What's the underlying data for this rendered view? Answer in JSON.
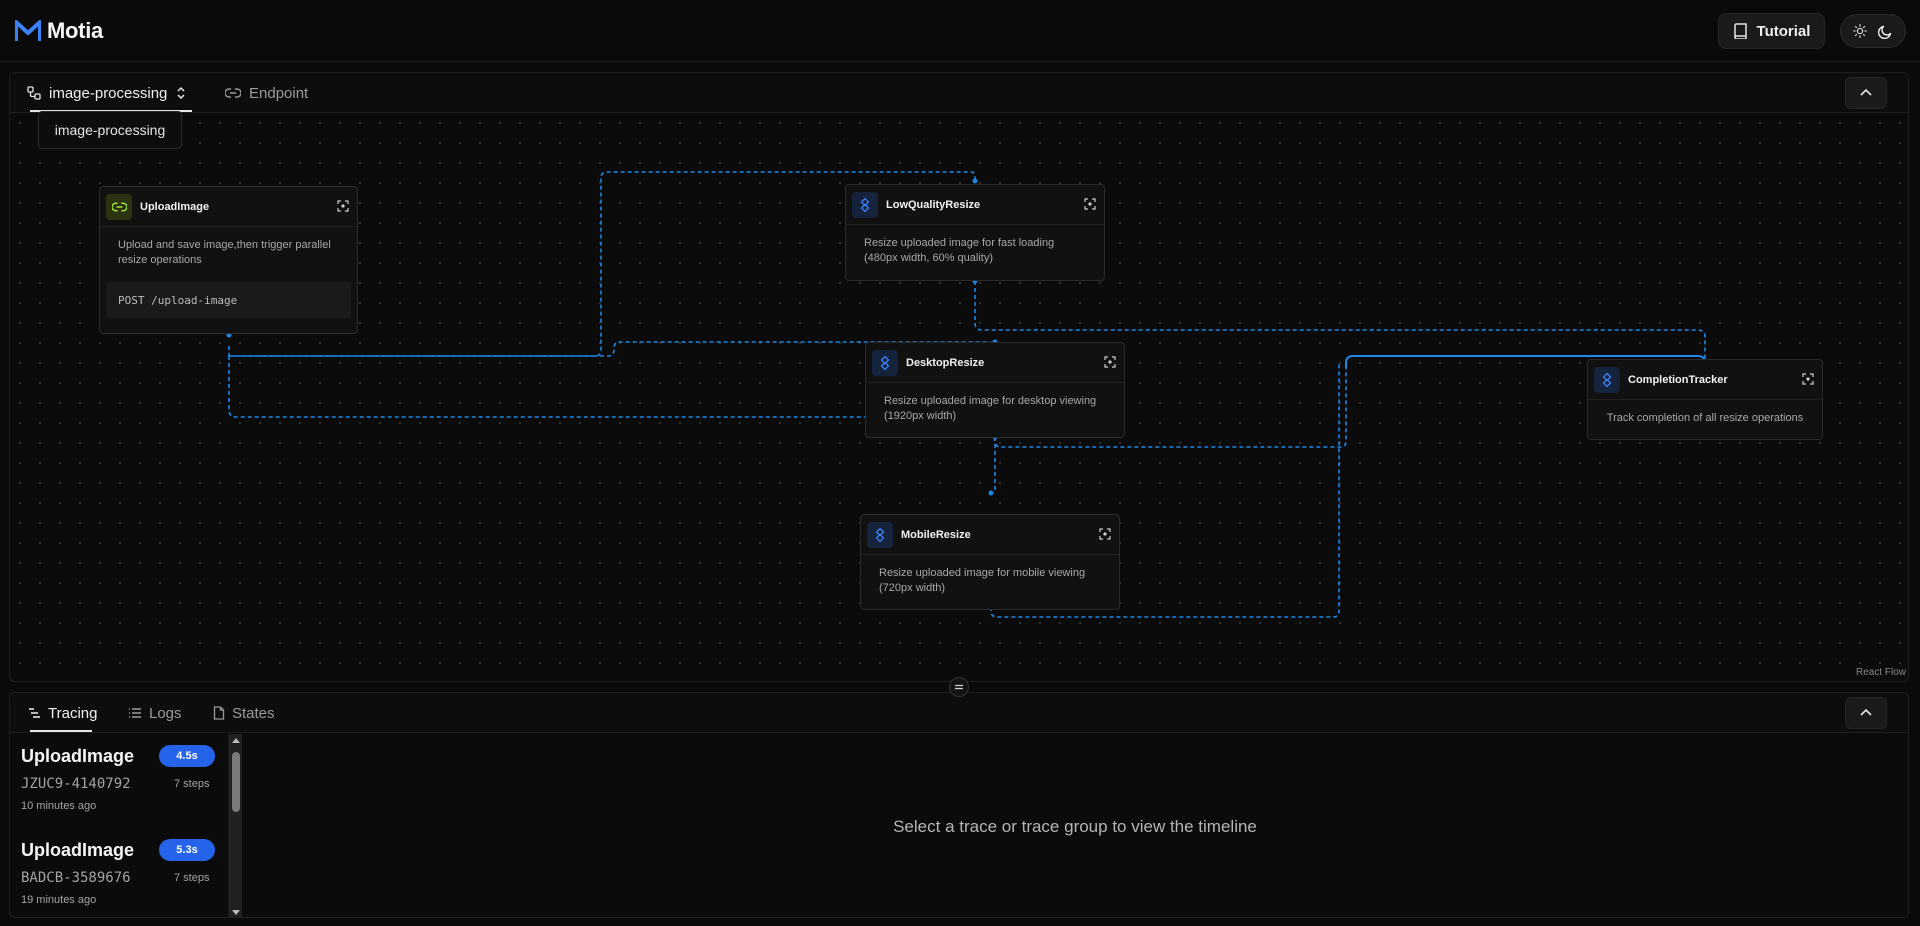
{
  "app": {
    "name": "Motia",
    "tutorial_label": "Tutorial",
    "theme_icons": [
      "sun-icon",
      "moon-icon"
    ]
  },
  "flow": {
    "selected": "image-processing",
    "dropdown_option": "image-processing",
    "endpoint_tab": "Endpoint",
    "attribution": "React Flow",
    "edge_color": "#1e88e5",
    "nodes": {
      "upload": {
        "title": "UploadImage",
        "description": "Upload and save image,then trigger parallel resize operations",
        "code": "POST /upload-image",
        "icon": "link-icon"
      },
      "lowquality": {
        "title": "LowQualityResize",
        "description": "Resize uploaded image for fast loading (480px width, 60% quality)",
        "icon": "event-icon"
      },
      "desktop": {
        "title": "DesktopResize",
        "description": "Resize uploaded image for desktop viewing (1920px width)",
        "icon": "event-icon"
      },
      "mobile": {
        "title": "MobileResize",
        "description": "Resize uploaded image for mobile viewing (720px width)",
        "icon": "event-icon"
      },
      "completion": {
        "title": "CompletionTracker",
        "description": "Track completion of all resize operations",
        "icon": "event-icon"
      }
    }
  },
  "bottom": {
    "tabs": [
      "Tracing",
      "Logs",
      "States"
    ],
    "active_tab": "Tracing",
    "traces": [
      {
        "name": "UploadImage",
        "duration": "4.5s",
        "id": "JZUC9-4140792",
        "steps": "7 steps",
        "time": "10 minutes ago"
      },
      {
        "name": "UploadImage",
        "duration": "5.3s",
        "id": "BADCB-3589676",
        "steps": "7 steps",
        "time": "19 minutes ago"
      }
    ],
    "empty_message": "Select a trace or trace group to view the timeline"
  }
}
